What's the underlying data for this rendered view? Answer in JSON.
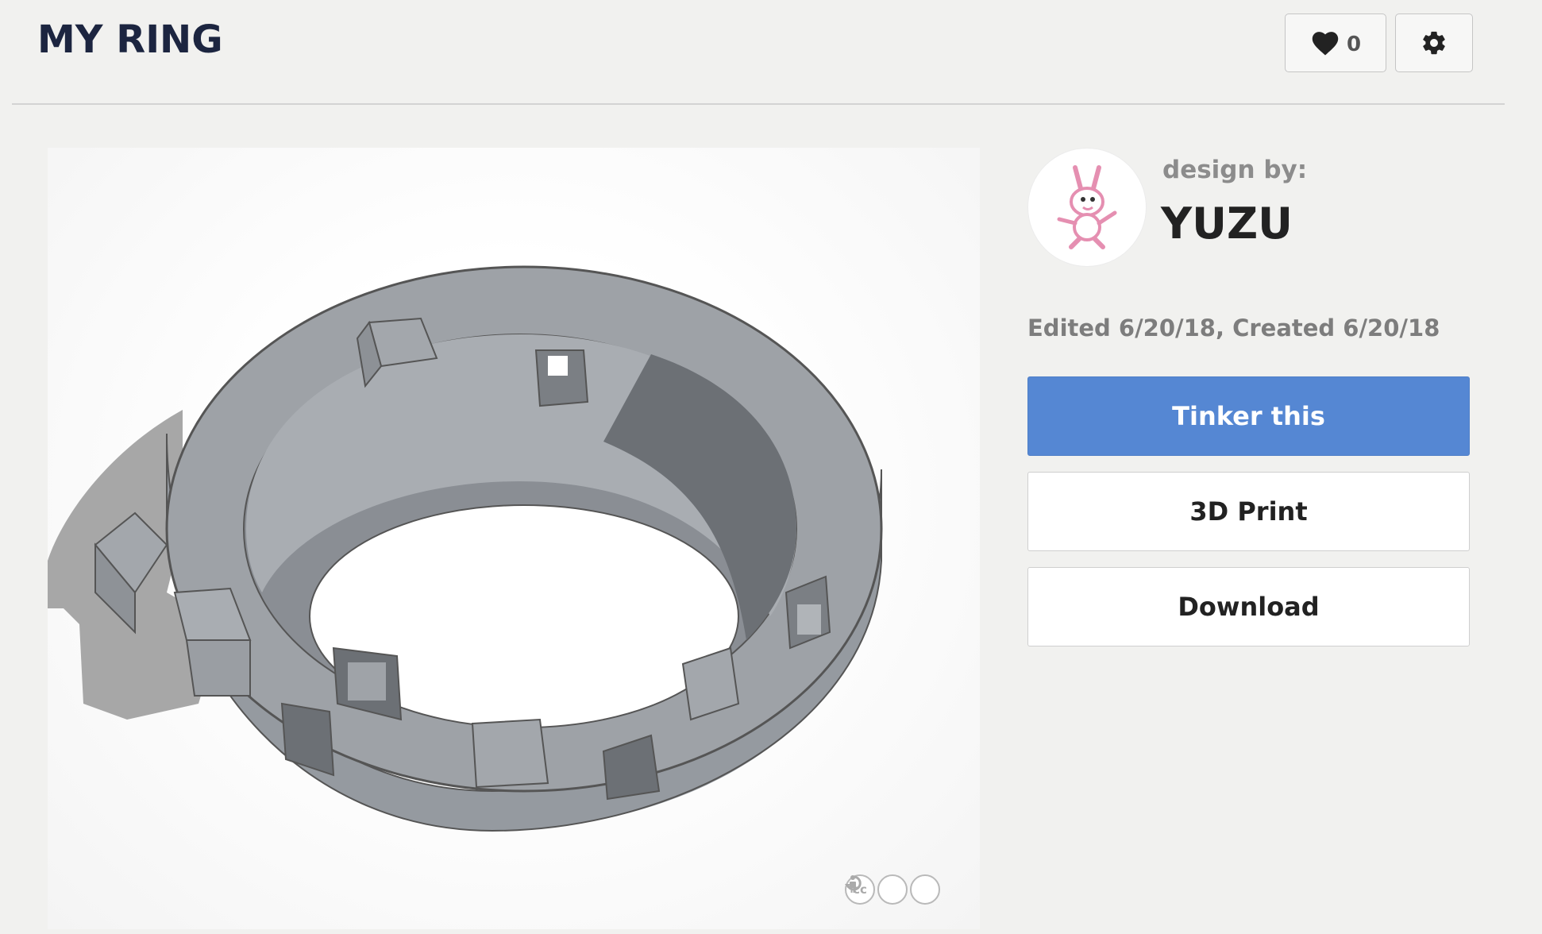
{
  "header": {
    "title": "MY RING",
    "like_count": "0"
  },
  "designer": {
    "label": "design by:",
    "name": "YUZU"
  },
  "meta": {
    "dates": "Edited 6/20/18, Created 6/20/18"
  },
  "actions": {
    "tinker_label": "Tinker this",
    "print_label": "3D Print",
    "download_label": "Download"
  },
  "license": {
    "cc_text": "cc"
  },
  "icons": {
    "like": "heart-icon",
    "settings": "gear-icon",
    "license": [
      "cc-icon",
      "by-icon",
      "sa-icon"
    ]
  },
  "colors": {
    "primary": "#5587d3",
    "title": "#1c2540",
    "model_gray": "#9b9ea3"
  }
}
